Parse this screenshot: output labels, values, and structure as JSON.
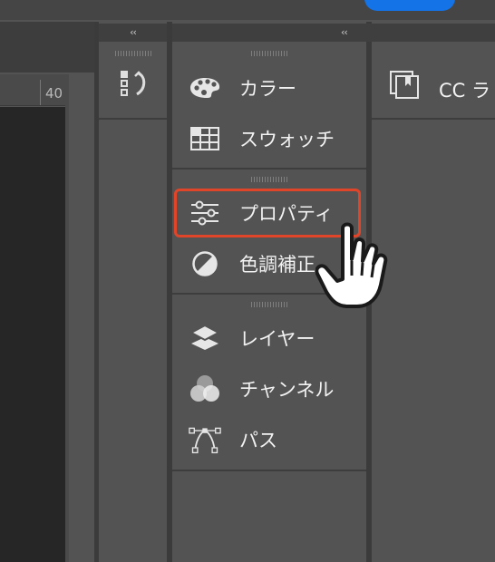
{
  "window": {
    "collapse_left": "‹‹",
    "collapse_right": "‹‹"
  },
  "ruler": {
    "label": "40"
  },
  "panels": {
    "groups": [
      {
        "items": [
          {
            "label": "カラー",
            "icon": "palette-icon"
          },
          {
            "label": "スウォッチ",
            "icon": "swatches-grid-icon"
          }
        ]
      },
      {
        "items": [
          {
            "label": "プロパティ",
            "icon": "sliders-icon"
          },
          {
            "label": "色調補正",
            "icon": "adjustments-circle-icon"
          }
        ]
      },
      {
        "items": [
          {
            "label": "レイヤー",
            "icon": "layers-icon"
          },
          {
            "label": "チャンネル",
            "icon": "channels-icon"
          },
          {
            "label": "パス",
            "icon": "path-icon"
          }
        ]
      }
    ]
  },
  "right_panel": {
    "label": "CC ラ"
  },
  "colors": {
    "highlight": "#e0452a",
    "accent": "#1473e6"
  }
}
